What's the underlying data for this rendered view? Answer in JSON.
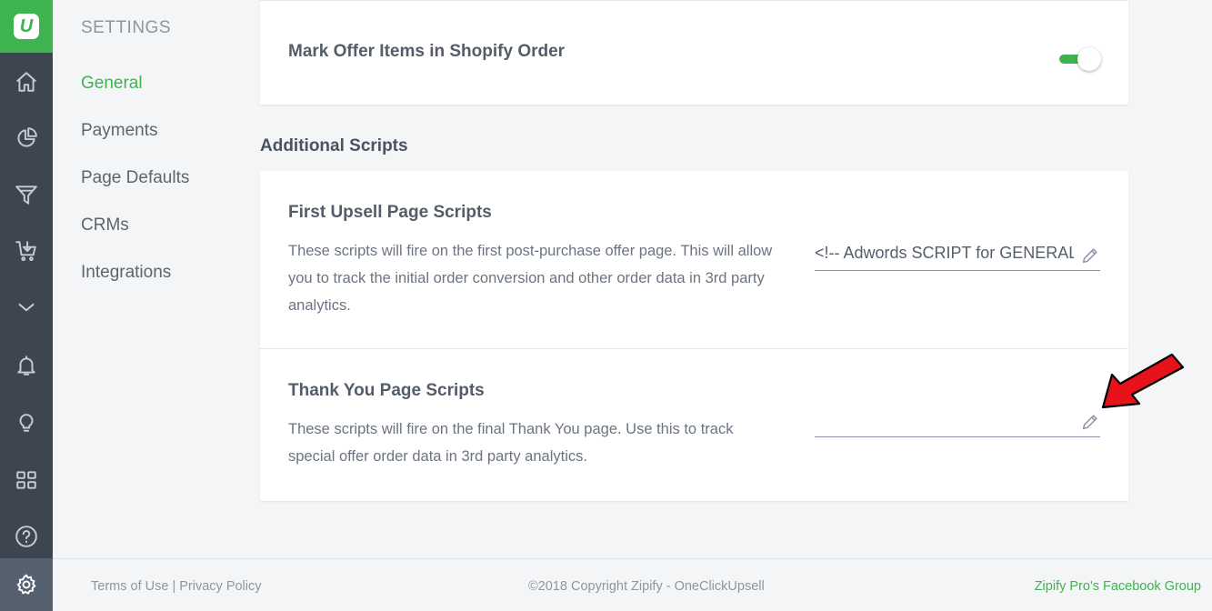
{
  "brand": {
    "accent": "#3fb34f",
    "rail_bg": "#3d4650",
    "logo_letter": "U"
  },
  "rail": {
    "icons": [
      "home-icon",
      "analytics-pie-icon",
      "funnel-icon",
      "cart-upsell-icon",
      "chevron-down-icon",
      "bell-icon",
      "lightbulb-icon",
      "grid-apps-icon",
      "help-icon",
      "settings-gear-icon"
    ],
    "active": "settings-gear-icon"
  },
  "subnav": {
    "heading": "SETTINGS",
    "items": [
      {
        "label": "General",
        "active": true
      },
      {
        "label": "Payments",
        "active": false
      },
      {
        "label": "Page Defaults",
        "active": false
      },
      {
        "label": "CRMs",
        "active": false
      },
      {
        "label": "Integrations",
        "active": false
      }
    ]
  },
  "general": {
    "mark_offer": {
      "label": "Mark Offer Items in Shopify Order",
      "enabled": true
    }
  },
  "additional_scripts": {
    "title": "Additional Scripts",
    "first_upsell": {
      "title": "First Upsell Page Scripts",
      "description": "These scripts will fire on the first post-purchase offer page. This will allow you to track the initial order conversion and other order data in 3rd party analytics.",
      "value": "<!-- Adwords SCRIPT for GENERAL"
    },
    "thank_you": {
      "title": "Thank You Page Scripts",
      "description": "These scripts will fire on the final Thank You page. Use this to track special offer order data in 3rd party analytics.",
      "value": ""
    }
  },
  "annotation": {
    "arrow_color": "#e8121a"
  },
  "footer": {
    "terms": "Terms of Use",
    "separator": " | ",
    "privacy": "Privacy Policy",
    "copyright": "©2018 Copyright Zipify - OneClickUpsell",
    "facebook": "Zipify Pro's Facebook Group"
  }
}
